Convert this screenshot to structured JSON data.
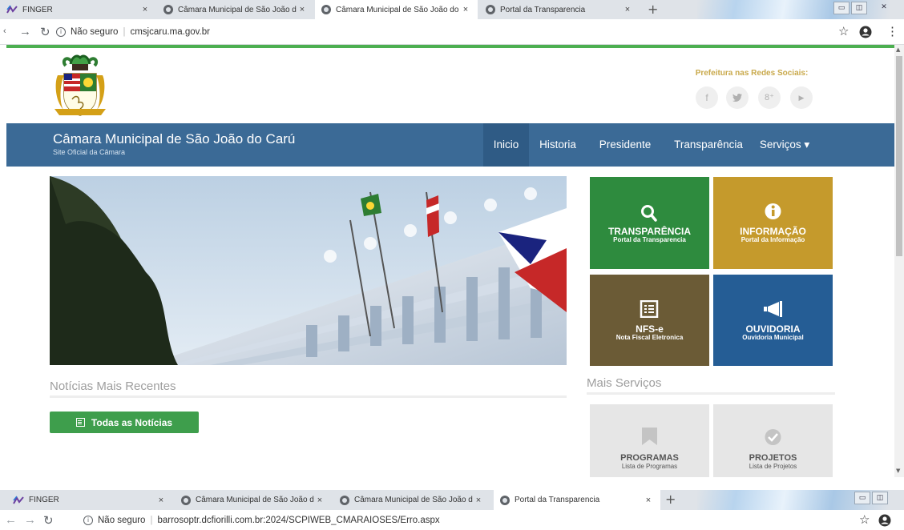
{
  "browser_top": {
    "tabs": [
      {
        "label": "FINGER",
        "close": "×"
      },
      {
        "label": "Câmara Municipal de São João do Carú",
        "close": "×"
      },
      {
        "label": "Câmara Municipal de São João do Carú",
        "close": "×"
      },
      {
        "label": "Portal da Transparencia",
        "close": "×"
      }
    ],
    "new_tab": "+",
    "security_text": "Não seguro",
    "url": "cmsjcaru.ma.gov.br"
  },
  "browser_bottom": {
    "tabs": [
      {
        "label": "FINGER",
        "close": "×"
      },
      {
        "label": "Câmara Municipal de São João do Carú",
        "close": "×"
      },
      {
        "label": "Câmara Municipal de São João do Carú",
        "close": "×"
      },
      {
        "label": "Portal da Transparencia",
        "close": "×"
      }
    ],
    "new_tab": "+",
    "security_text": "Não seguro",
    "url": "barrosoptr.dcfiorilli.com.br:2024/SCPIWEB_CMARAIOSES/Erro.aspx"
  },
  "social": {
    "title": "Prefeitura nas Redes Sociais:",
    "icons": [
      "f",
      "t",
      "8⁺",
      "▶"
    ]
  },
  "header": {
    "site_title": "Câmara Municipal de São João do Carú",
    "site_subtitle": "Site Oficial da Câmara",
    "menu": [
      "Inicio",
      "Historia",
      "Presidente",
      "Transparência",
      "Serviços ▾"
    ]
  },
  "news": {
    "title": "Notícias Mais Recentes",
    "button": "Todas as Notícias"
  },
  "tiles": [
    {
      "title": "TRANSPARÊNCIA",
      "subtitle": "Portal da Transparencia",
      "icon": "search-icon",
      "color": "#2e8b3e"
    },
    {
      "title": "INFORMAÇÃO",
      "subtitle": "Portal da Informação",
      "icon": "info-icon",
      "color": "#c59a2c"
    },
    {
      "title": "NFS-e",
      "subtitle": "Nota Fiscal Eletronica",
      "icon": "list-icon",
      "color": "#6b5b36"
    },
    {
      "title": "OUVIDORIA",
      "subtitle": "Ouvidoria Municipal",
      "icon": "megaphone-icon",
      "color": "#255d95"
    }
  ],
  "more_services": {
    "title": "Mais Serviços",
    "tiles": [
      {
        "title": "PROGRAMAS",
        "subtitle": "Lista de Programas",
        "icon": "bookmark-icon"
      },
      {
        "title": "PROJETOS",
        "subtitle": "Lista de Projetos",
        "icon": "check-circle-icon"
      }
    ]
  }
}
